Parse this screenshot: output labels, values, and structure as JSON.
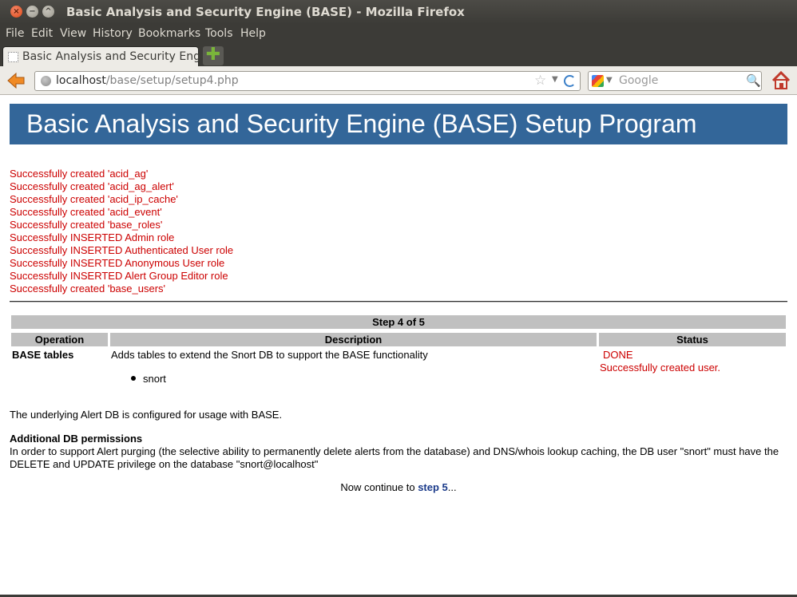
{
  "window": {
    "title": "Basic Analysis and Security Engine (BASE) - Mozilla Firefox",
    "close_glyph": "×",
    "min_glyph": "−",
    "max_glyph": "^"
  },
  "menu": {
    "file": "File",
    "edit": "Edit",
    "view": "View",
    "history": "History",
    "bookmarks": "Bookmarks",
    "tools": "Tools",
    "help": "Help"
  },
  "tab": {
    "title": "Basic Analysis and Security Eng...",
    "new_tab_glyph": "✚"
  },
  "nav": {
    "url_host": "localhost",
    "url_path": "/base/setup/setup4.php",
    "star_glyph": "☆",
    "dropdown_glyph": "▼",
    "search_placeholder": "Google",
    "search_glyph": "🔍"
  },
  "page": {
    "header": "Basic Analysis and Security Engine (BASE) Setup Program",
    "messages": [
      "Successfully created 'acid_ag'",
      "Successfully created 'acid_ag_alert'",
      "Successfully created 'acid_ip_cache'",
      "Successfully created 'acid_event'",
      "Successfully created 'base_roles'",
      "Successfully INSERTED Admin role",
      "Successfully INSERTED Authenticated User role",
      "Successfully INSERTED Anonymous User role",
      "Successfully INSERTED Alert Group Editor role",
      "Successfully created 'base_users'"
    ],
    "step": "Step 4 of 5",
    "columns": {
      "operation": "Operation",
      "description": "Description",
      "status": "Status"
    },
    "row": {
      "operation": "BASE tables",
      "description": "Adds tables to extend the Snort DB to support the BASE functionality",
      "db_item": "snort",
      "status_done": "DONE",
      "status_msg": "Successfully created user."
    },
    "configured": "The underlying Alert DB is configured for usage with BASE.",
    "perm_heading": "Additional DB permissions",
    "perm_text": "In order to support Alert purging (the selective ability to permanently delete alerts from the database) and DNS/whois lookup caching, the DB user \"snort\" must have the DELETE and UPDATE privilege on the database \"snort@localhost\"",
    "continue_prefix": "Now continue to ",
    "continue_link": "step 5",
    "continue_suffix": "..."
  },
  "colors": {
    "header_bg": "#336699",
    "message_red": "#cc0000",
    "table_header": "#c0c0c0",
    "link": "#1a3a8a"
  }
}
